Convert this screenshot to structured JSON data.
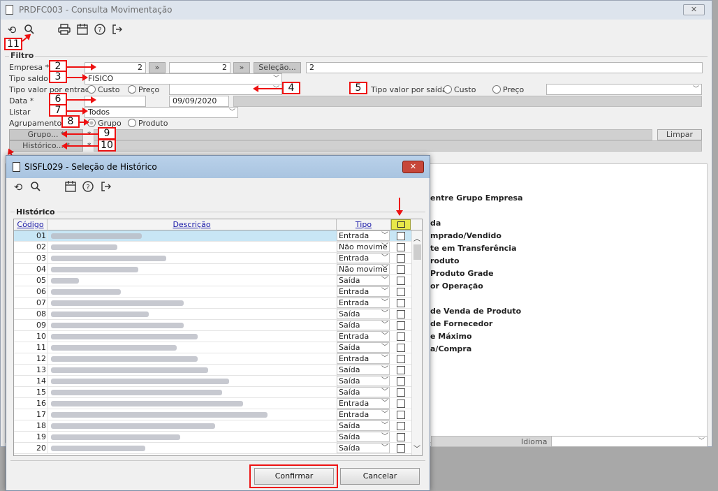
{
  "main": {
    "title": "PRDFC003 - Consulta Movimentação",
    "close": "✕",
    "filtro_legend": "Filtro",
    "empresa_label": "Empresa *",
    "empresa_from": "2",
    "empresa_to": "2",
    "selecao_button": "Seleção...",
    "selecao_value": "2",
    "tipo_saldo_label": "Tipo saldo",
    "tipo_saldo_value": "FISICO",
    "tipo_valor_entrada_label": "Tipo valor por entrada",
    "tipo_valor_saida_label": "Tipo valor por saída",
    "custo_label": "Custo",
    "preco_label": "Preço",
    "data_label": "Data *",
    "data_to": "09/09/2020",
    "listar_label": "Listar",
    "listar_value": "Todos",
    "agrupamento_label": "Agrupamento *",
    "grupo_radio": "Grupo",
    "produto_radio": "Produto",
    "grupo_button": "Grupo... *",
    "historico_button": "Histórico... *",
    "limpar_button": "Limpar",
    "asterisk": "*",
    "idioma_label": "Idioma",
    "background_reports": [
      "entre Grupo Empresa",
      "da",
      "mprado/Vendido",
      "te em Transferência",
      "roduto",
      "Produto Grade",
      "or Operação",
      "de Venda de Produto",
      "de Fornecedor",
      "e Máximo",
      "a/Compra"
    ]
  },
  "callouts": [
    "11",
    "2",
    "3",
    "4",
    "5",
    "6",
    "7",
    "8",
    "9",
    "10"
  ],
  "dialog": {
    "title": "SISFL029 - Seleção de Histórico",
    "close": "✕",
    "group_label": "Histórico",
    "col_codigo": "Código",
    "col_descricao": "Descrição",
    "col_tipo": "Tipo",
    "rows": [
      {
        "codigo": "01",
        "tipo": "Entrada"
      },
      {
        "codigo": "02",
        "tipo": "Não movime"
      },
      {
        "codigo": "03",
        "tipo": "Entrada"
      },
      {
        "codigo": "04",
        "tipo": "Não movime"
      },
      {
        "codigo": "05",
        "tipo": "Saída"
      },
      {
        "codigo": "06",
        "tipo": "Entrada"
      },
      {
        "codigo": "07",
        "tipo": "Entrada"
      },
      {
        "codigo": "08",
        "tipo": "Saída"
      },
      {
        "codigo": "09",
        "tipo": "Saída"
      },
      {
        "codigo": "10",
        "tipo": "Entrada"
      },
      {
        "codigo": "11",
        "tipo": "Saída"
      },
      {
        "codigo": "12",
        "tipo": "Entrada"
      },
      {
        "codigo": "13",
        "tipo": "Saída"
      },
      {
        "codigo": "14",
        "tipo": "Saída"
      },
      {
        "codigo": "15",
        "tipo": "Saída"
      },
      {
        "codigo": "16",
        "tipo": "Entrada"
      },
      {
        "codigo": "17",
        "tipo": "Entrada"
      },
      {
        "codigo": "18",
        "tipo": "Saída"
      },
      {
        "codigo": "19",
        "tipo": "Saída"
      },
      {
        "codigo": "20",
        "tipo": "Saída"
      }
    ],
    "confirmar": "Confirmar",
    "cancelar": "Cancelar"
  },
  "colors": {
    "highlight": "#e11111",
    "header_check": "#e8e84a",
    "selected_row": "#c8e6f5"
  }
}
